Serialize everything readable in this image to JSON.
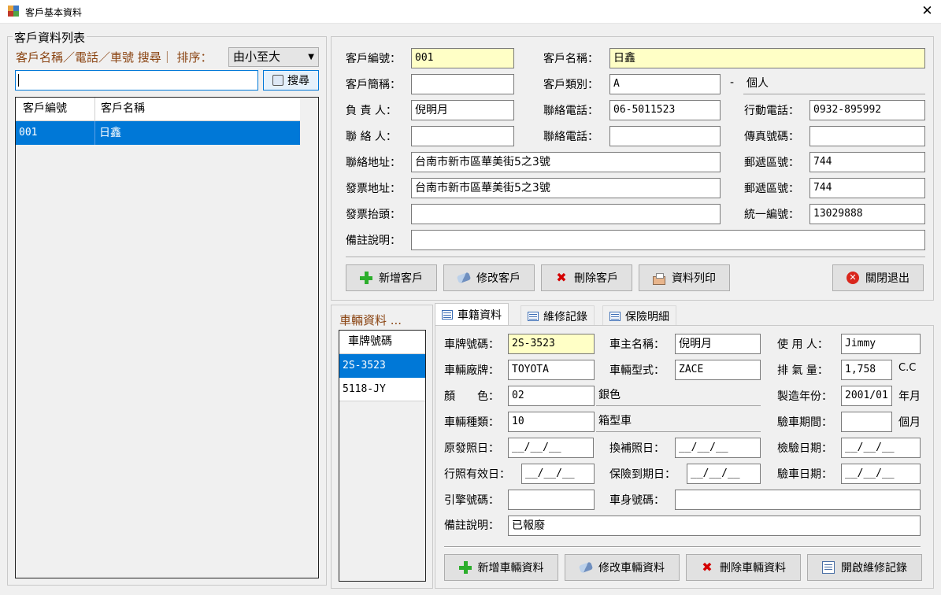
{
  "window": {
    "title": "客戶基本資料",
    "close_glyph": "✕"
  },
  "left": {
    "group_title": "客戶資料列表",
    "search_hint": "客戶名稱／電話／車號 搜尋｜ 排序：",
    "sort_value": "由小至大",
    "search_value": "",
    "search_button": "搜尋",
    "columns": [
      "客戶編號",
      "客戶名稱"
    ],
    "rows": [
      {
        "id": "001",
        "name": "日鑫"
      }
    ]
  },
  "customer": {
    "labels": {
      "id": "客戶編號：",
      "name": "客戶名稱：",
      "short": "客戶簡稱：",
      "category": "客戶類別：",
      "owner": "負 責 人：",
      "tel1": "聯絡電話：",
      "mobile": "行動電話：",
      "contact": "聯 絡 人：",
      "tel2": "聯絡電話：",
      "fax": "傳真號碼：",
      "address": "聯絡地址：",
      "zip1": "郵遞區號：",
      "inv_address": "發票地址：",
      "zip2": "郵遞區號：",
      "inv_title": "發票抬頭：",
      "tax_id": "統一編號：",
      "memo": "備註說明："
    },
    "values": {
      "id": "001",
      "name": "日鑫",
      "short": "",
      "category": "A",
      "category_dash": "-",
      "category_name": "個人",
      "owner": "倪明月",
      "tel1": "06-5011523",
      "mobile": "0932-895992",
      "contact": "",
      "tel2": "",
      "fax": "",
      "address": "台南市新市區華美街5之3號",
      "zip1": "744",
      "inv_address": "台南市新市區華美街5之3號",
      "zip2": "744",
      "inv_title": "",
      "tax_id": "13029888",
      "memo": ""
    },
    "buttons": {
      "add": "新增客戶",
      "edit": "修改客戶",
      "delete": "刪除客戶",
      "print": "資料列印",
      "exit": "關閉退出"
    }
  },
  "vehicles": {
    "title": "車輛資料 ...",
    "column": "車牌號碼",
    "rows": [
      "2S-3523",
      "5118-JY"
    ]
  },
  "tabs": [
    "車籍資料",
    "維修記錄",
    "保險明細"
  ],
  "vehicle": {
    "labels": {
      "plate": "車牌號碼：",
      "owner": "車主名稱：",
      "user": "使 用 人：",
      "brand": "車輛廠牌：",
      "model": "車輛型式：",
      "cc": "排 氣 量：",
      "color": "顏　　色：",
      "year": "製造年份：",
      "type": "車輛種類：",
      "inspect_period": "驗車期間：",
      "first_license": "原發照日：",
      "reissue": "換補照日：",
      "check_date": "檢驗日期：",
      "license_valid": "行照有效日：",
      "insurance_due": "保險到期日：",
      "inspect_date": "驗車日期：",
      "engine_no": "引擎號碼：",
      "body_no": "車身號碼：",
      "memo": "備註說明："
    },
    "values": {
      "plate": "2S-3523",
      "owner": "倪明月",
      "user": "Jimmy",
      "brand": "TOYOTA",
      "model": "ZACE",
      "cc": "1,758",
      "cc_unit": "C.C",
      "color_code": "02",
      "color_name": "銀色",
      "year": "2001/01",
      "year_unit": "年月",
      "type_code": "10",
      "type_name": "箱型車",
      "inspect_period": "",
      "period_unit": "個月",
      "first_license": "__/__/__",
      "reissue": "__/__/__",
      "check_date": "__/__/__",
      "license_valid": "__/__/__",
      "insurance_due": "__/__/__",
      "inspect_date": "__/__/__",
      "engine_no": "",
      "body_no": "",
      "memo": "已報廢"
    },
    "buttons": {
      "add": "新增車輛資料",
      "edit": "修改車輛資料",
      "delete": "刪除車輛資料",
      "open_repair": "開啟維修記錄"
    }
  }
}
